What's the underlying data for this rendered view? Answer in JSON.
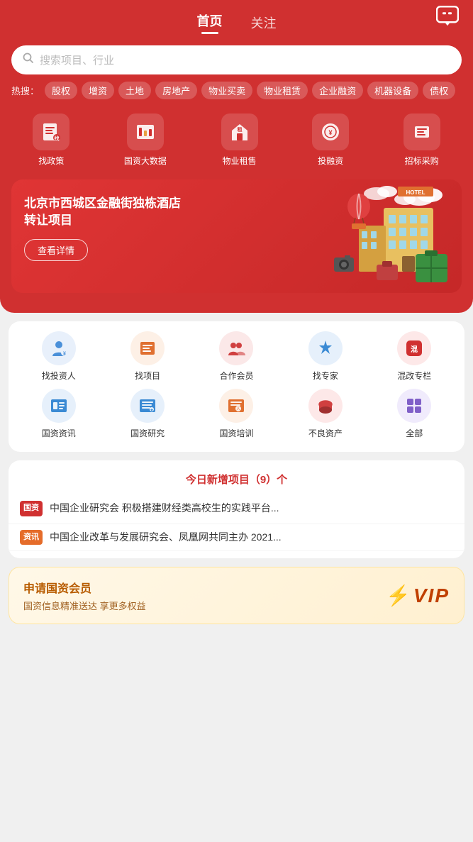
{
  "header": {
    "nav_tabs": [
      {
        "label": "首页",
        "active": true
      },
      {
        "label": "关注",
        "active": false
      }
    ],
    "message_icon": "message-icon"
  },
  "search": {
    "placeholder": "搜索项目、行业"
  },
  "hot_search": {
    "label": "热搜：",
    "tags": [
      "股权",
      "增资",
      "土地",
      "房地产",
      "物业买卖",
      "物业租赁",
      "企业融资",
      "机器设备",
      "债权"
    ]
  },
  "quick_icons": [
    {
      "label": "找政策",
      "icon": "policy"
    },
    {
      "label": "国资大数据",
      "icon": "data"
    },
    {
      "label": "物业租售",
      "icon": "property"
    },
    {
      "label": "投融资",
      "icon": "investment"
    },
    {
      "label": "招标采购",
      "icon": "procurement"
    }
  ],
  "banner": {
    "title": "北京市西城区金融街独栋酒店转让项目",
    "btn_label": "查看详情",
    "dots": 7,
    "active_dot": 0
  },
  "categories_row1": [
    {
      "label": "找投资人",
      "color": "#4a90d9",
      "bg": "#e8f0fb"
    },
    {
      "label": "找项目",
      "color": "#e07030",
      "bg": "#fdf0e6"
    },
    {
      "label": "合作会员",
      "color": "#d04040",
      "bg": "#fbe8e8"
    },
    {
      "label": "找专家",
      "color": "#3a8ad4",
      "bg": "#e6f0fb"
    },
    {
      "label": "混改专栏",
      "color": "#d03030",
      "bg": "#fde8e8"
    }
  ],
  "categories_row2": [
    {
      "label": "国资资讯",
      "color": "#3a8ad4",
      "bg": "#e6f0fb"
    },
    {
      "label": "国资研究",
      "color": "#3a8ad4",
      "bg": "#e6f0fb"
    },
    {
      "label": "国资培训",
      "color": "#e07030",
      "bg": "#fdf0e6"
    },
    {
      "label": "不良资产",
      "color": "#d04040",
      "bg": "#fde8e8"
    },
    {
      "label": "全部",
      "color": "#8060c8",
      "bg": "#f0ebfc"
    }
  ],
  "today_new": "今日新增项目（9）个",
  "news_items": [
    {
      "badge": "国资",
      "badge_line2": "",
      "text": "中国企业研究会 积极搭建财经类高校生的实践平台..."
    },
    {
      "badge": "资讯",
      "badge_line2": "",
      "text": "中国企业改革与发展研究会、凤凰网共同主办 2021..."
    }
  ],
  "vip": {
    "title": "申请国资会员",
    "desc": "国资信息精准送达 享更多权益",
    "icon": "lightning",
    "badge": "VIP"
  }
}
